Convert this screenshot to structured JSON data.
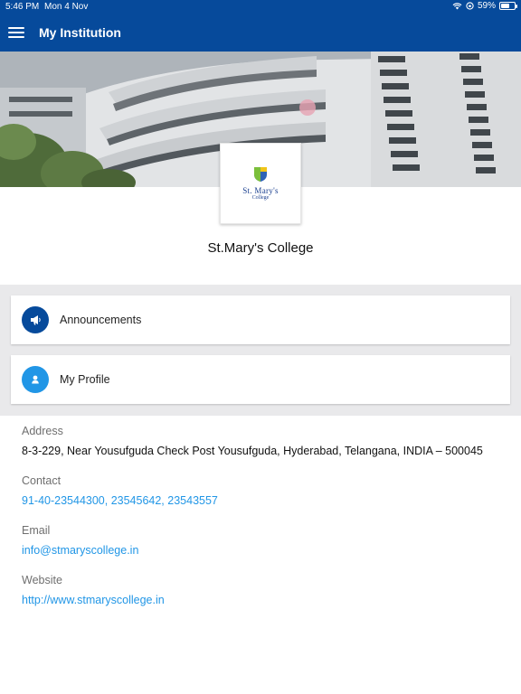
{
  "status_bar": {
    "time": "5:46 PM",
    "date": "Mon 4 Nov",
    "battery": "59%"
  },
  "app_bar": {
    "title": "My Institution"
  },
  "institution": {
    "name": "St.Mary's College",
    "logo_line1": "St. Mary's",
    "logo_line2": "College"
  },
  "menu": {
    "items": [
      {
        "label": "Announcements",
        "icon": "megaphone-icon",
        "color": "#064a9b"
      },
      {
        "label": "My Profile",
        "icon": "person-icon",
        "color": "#2196e6"
      }
    ]
  },
  "details": {
    "address_label": "Address",
    "address_value": "8-3-229, Near Yousufguda Check Post Yousufguda, Hyderabad, Telangana, INDIA – 500045",
    "contact_label": "Contact",
    "contact_value": "91-40-23544300, 23545642, 23543557",
    "email_label": "Email",
    "email_value": "info@stmaryscollege.in",
    "website_label": "Website",
    "website_value": "http://www.stmaryscollege.in"
  },
  "colors": {
    "primary": "#064a9b",
    "link": "#2196e6",
    "background_grey": "#e9e9eb"
  }
}
